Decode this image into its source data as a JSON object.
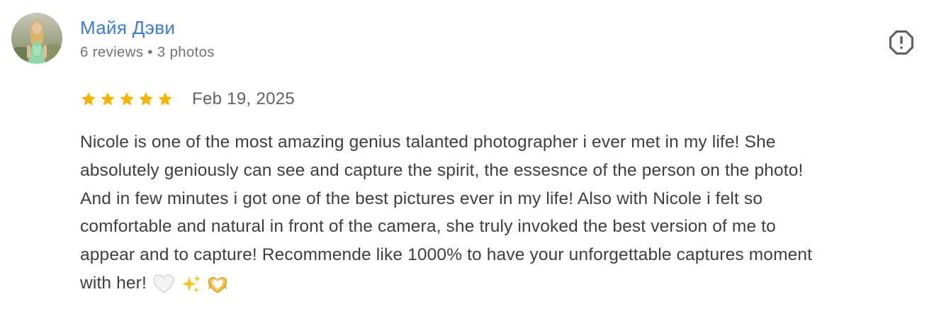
{
  "author": {
    "name": "Майя Дэви",
    "reviews": "6 reviews",
    "separator": "•",
    "photos": "3 photos"
  },
  "report_icon": "report-flag-icon",
  "review": {
    "rating": 5,
    "max_rating": 5,
    "star_color": "#f6b400",
    "date": "Feb 19, 2025",
    "lines": [
      "Nicole is one of the most amazing genius talanted photographer i ever met in my life! She",
      "absolutely geniously can see and capture the spirit, the essesnce of the person on the photo!",
      "And in few minutes i got one of the best pictures ever in my life! Also with Nicole i felt so",
      "comfortable and natural in front of the camera, she truly invoked the best version of me to",
      "appear and to capture! Recommende like 1000% to have your unforgettable captures moment",
      "with her!"
    ],
    "emojis": [
      "white-heart-icon",
      "sparkles-icon",
      "heart-hands-icon"
    ]
  },
  "colors": {
    "name": "#3c7bd9",
    "meta": "#70757a",
    "text": "#3c4043"
  }
}
